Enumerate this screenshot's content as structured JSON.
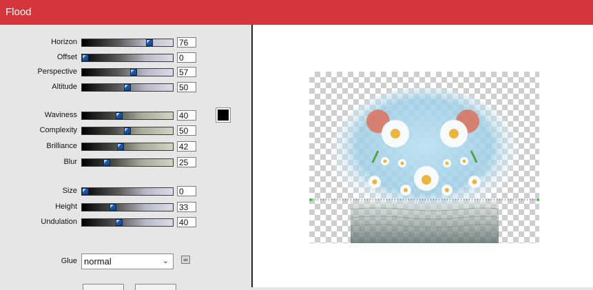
{
  "window": {
    "title": "Flood"
  },
  "params": [
    {
      "label": "Horizon",
      "value": "76",
      "level": 0.76
    },
    {
      "label": "Offset",
      "value": "0",
      "level": 0.0
    },
    {
      "label": "Perspective",
      "value": "57",
      "level": 0.57
    },
    {
      "label": "Altitude",
      "value": "50",
      "level": 0.5
    },
    {
      "label": "Waviness",
      "value": "40",
      "level": 0.4
    },
    {
      "label": "Complexity",
      "value": "50",
      "level": 0.5
    },
    {
      "label": "Brilliance",
      "value": "42",
      "level": 0.42
    },
    {
      "label": "Blur",
      "value": "25",
      "level": 0.25
    },
    {
      "label": "Size",
      "value": "0",
      "level": 0.0
    },
    {
      "label": "Height",
      "value": "33",
      "level": 0.33
    },
    {
      "label": "Undulation",
      "value": "40",
      "level": 0.4
    }
  ],
  "color_swatch": {
    "color": "#000000"
  },
  "glue": {
    "label": "Glue",
    "value": "normal"
  },
  "colors": {
    "titlebar": "#d4363c",
    "thumb": "#1f5aa6"
  }
}
